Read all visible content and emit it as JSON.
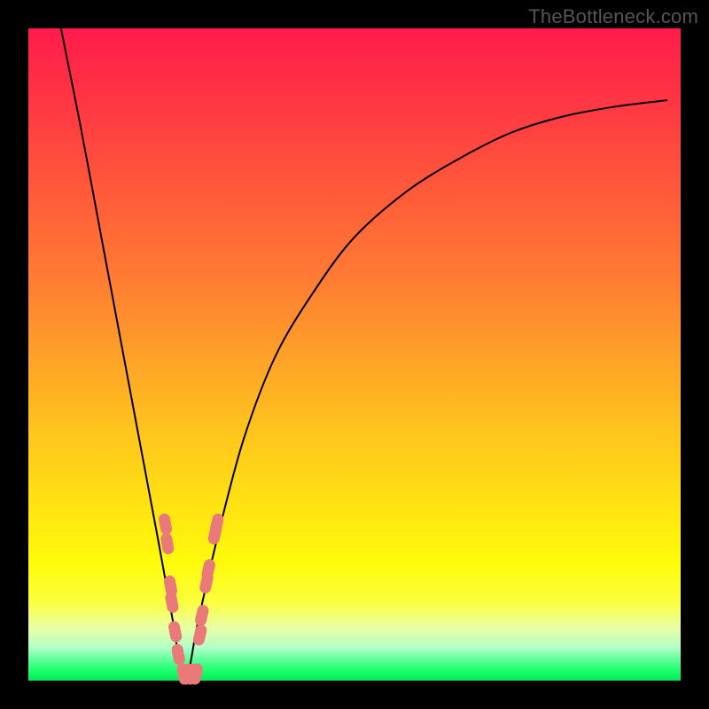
{
  "watermark": "TheBottleneck.com",
  "colors": {
    "frame": "#000000",
    "marker": "#ea7a7a",
    "curve": "#000000"
  },
  "chart_data": {
    "type": "line",
    "title": "",
    "xlabel": "",
    "ylabel": "",
    "xlim": [
      0,
      100
    ],
    "ylim": [
      0,
      100
    ],
    "grid": false,
    "optimum_x": 24,
    "series": [
      {
        "name": "bottleneck-curve",
        "x": [
          5,
          8,
          11,
          14,
          17,
          20,
          22,
          24,
          26,
          29,
          33,
          38,
          44,
          50,
          58,
          66,
          74,
          82,
          90,
          98
        ],
        "y": [
          100,
          85,
          69,
          53,
          37,
          21,
          10,
          0,
          9,
          22,
          37,
          50,
          60,
          68,
          75,
          80,
          84,
          86.5,
          88,
          89
        ]
      }
    ],
    "markers_left": [
      {
        "x": 21.0,
        "y": 24.0
      },
      {
        "x": 21.3,
        "y": 21.0
      },
      {
        "x": 21.8,
        "y": 14.5
      },
      {
        "x": 22.0,
        "y": 12.0
      },
      {
        "x": 22.5,
        "y": 7.5
      },
      {
        "x": 23.0,
        "y": 4.0
      },
      {
        "x": 23.8,
        "y": 1.0
      },
      {
        "x": 24.3,
        "y": 1.0
      },
      {
        "x": 25.0,
        "y": 1.0
      },
      {
        "x": 25.7,
        "y": 1.0
      }
    ],
    "markers_right": [
      {
        "x": 26.3,
        "y": 7.0
      },
      {
        "x": 26.6,
        "y": 10.0
      },
      {
        "x": 27.3,
        "y": 15.0
      },
      {
        "x": 27.6,
        "y": 17.0
      },
      {
        "x": 28.6,
        "y": 22.5
      },
      {
        "x": 28.9,
        "y": 24.0
      }
    ]
  }
}
